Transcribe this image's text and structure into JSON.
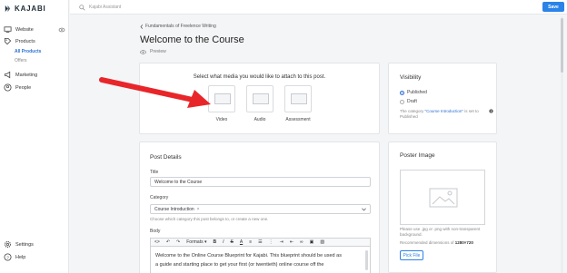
{
  "app": {
    "logo_text": "KAJABI"
  },
  "search": {
    "placeholder": "Kajabi Assistant"
  },
  "toolbar_top": {
    "save_label": "Save"
  },
  "sidebar": {
    "website": "Website",
    "products": "Products",
    "all_products": "All Products",
    "offers": "Offers",
    "marketing": "Marketing",
    "people": "People",
    "settings": "Settings",
    "help": "Help"
  },
  "header": {
    "breadcrumb": "Fundamentals of Freelence Writing",
    "title": "Welcome to the Course",
    "preview": "Preview"
  },
  "media": {
    "prompt": "Select what media you would like to attach to this post.",
    "options": [
      "Video",
      "Audio",
      "Assessment"
    ]
  },
  "visibility": {
    "title": "Visibility",
    "published": "Published",
    "draft": "Draft",
    "note_prefix": "The category ",
    "note_link": "\"Course Introduction\"",
    "note_suffix": " is set to Published"
  },
  "post_details": {
    "title": "Post Details",
    "title_label": "Title",
    "title_value": "Welcome to the Course",
    "category_label": "Category",
    "category_value": "Course Introduction",
    "category_help": "Choose which category this post belongs to, or create a new one.",
    "body_label": "Body",
    "formats_label": "Formats",
    "body_line1": "Welcome to the Online Course Blueprint for Kajabi. This blueprint should be used as",
    "body_line2": "a guide and starting place to get your first (or twentieth) online course off the"
  },
  "poster": {
    "title": "Poster Image",
    "help": "Please use .jpg or .png with non-transparent background.",
    "dims_prefix": "Recommended dimensions of ",
    "dims_value": "1280×720",
    "pick_label": "Pick File"
  },
  "colors": {
    "accent": "#2b83e8",
    "link": "#2b6fd6",
    "arrow": "#e8262a"
  }
}
